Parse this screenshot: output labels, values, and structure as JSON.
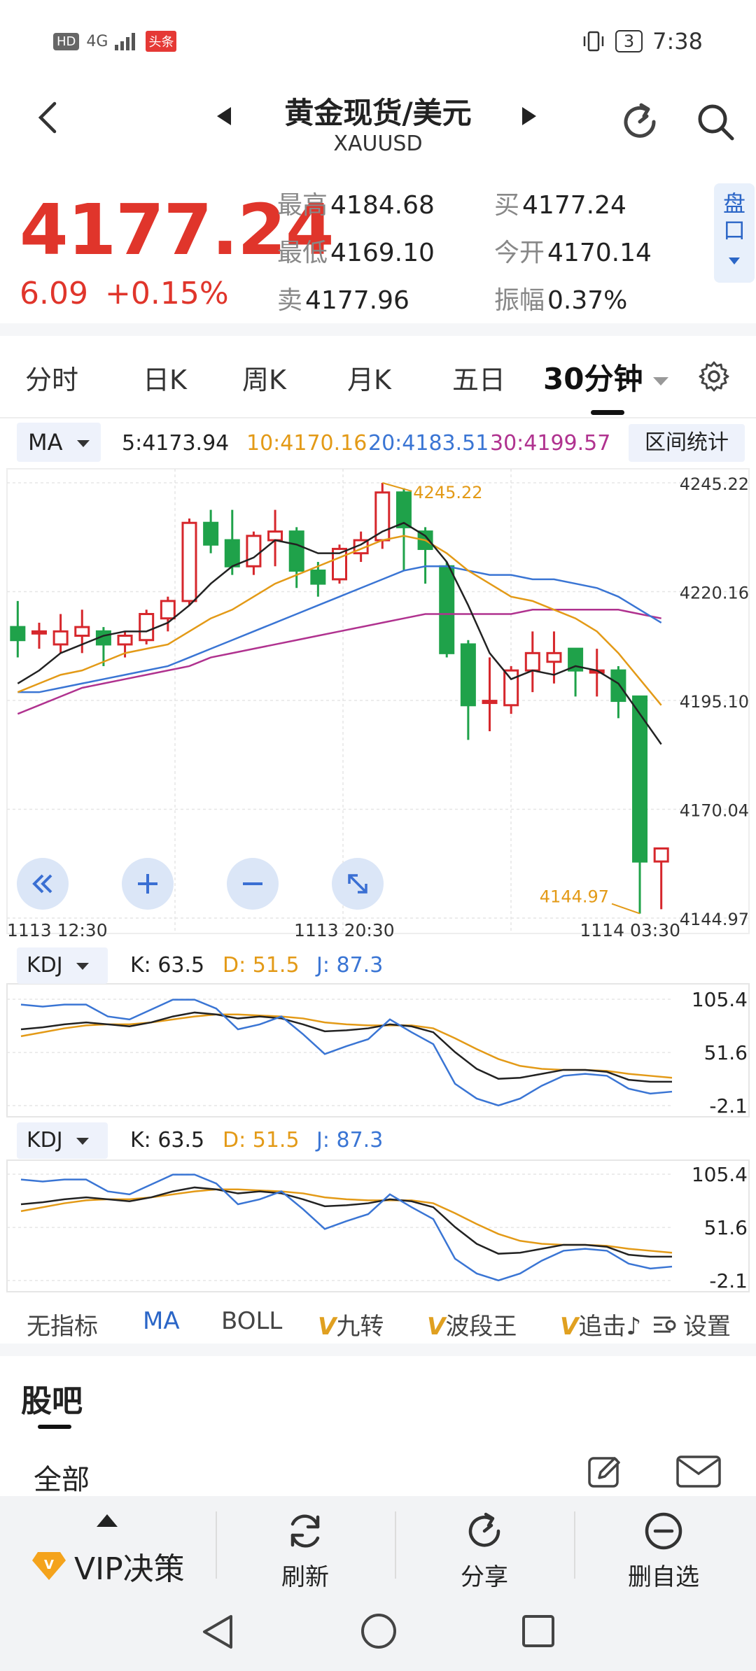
{
  "status": {
    "hd": "HD",
    "signal": "4G",
    "news_badge": "头条",
    "battery": "3",
    "time": "7:38"
  },
  "header": {
    "title": "黄金现货/美元",
    "symbol": "XAUUSD"
  },
  "quote": {
    "price": "4177.24",
    "change": "6.09",
    "change_pct": "+0.15%",
    "high_label": "最高",
    "high": "4184.68",
    "low_label": "最低",
    "low": "4169.10",
    "sell_label": "卖",
    "sell": "4177.96",
    "buy_label": "买",
    "buy": "4177.24",
    "open_label": "今开",
    "open": "4170.14",
    "amp_label": "振幅",
    "amp": "0.37%",
    "pankou": "盘口"
  },
  "tabs": [
    "分时",
    "日K",
    "周K",
    "月K",
    "五日",
    "30分钟"
  ],
  "ma_row": {
    "btn": "MA",
    "ma5": "5:4173.94",
    "ma10": "10:4170.16",
    "ma20": "20:4183.51",
    "ma30": "30:4199.57",
    "range_btn": "区间统计"
  },
  "colors": {
    "up": "#d6272c",
    "down": "#1fa24a",
    "ma5": "#222222",
    "ma10": "#e39a17",
    "ma20": "#3a75d4",
    "ma30": "#b0328f"
  },
  "chart_data": {
    "type": "candlestick",
    "y_ticks": [
      "4245.22",
      "4220.16",
      "4195.10",
      "4170.04",
      "4144.97"
    ],
    "ylim": [
      4144.97,
      4245.22
    ],
    "x_labels": [
      "1113  12:30",
      "1113  20:30",
      "1114  03:30"
    ],
    "max_label": "4245.22",
    "min_label": "4144.97",
    "candles": [
      {
        "o": 4212,
        "c": 4209,
        "h": 4218,
        "l": 4205
      },
      {
        "o": 4211,
        "c": 4211,
        "h": 4213,
        "l": 4207
      },
      {
        "o": 4208,
        "c": 4211,
        "h": 4215,
        "l": 4206
      },
      {
        "o": 4210,
        "c": 4212,
        "h": 4216,
        "l": 4206
      },
      {
        "o": 4211,
        "c": 4208,
        "h": 4212,
        "l": 4203
      },
      {
        "o": 4208,
        "c": 4210,
        "h": 4211,
        "l": 4205
      },
      {
        "o": 4209,
        "c": 4215,
        "h": 4216,
        "l": 4208
      },
      {
        "o": 4214,
        "c": 4218,
        "h": 4219,
        "l": 4211
      },
      {
        "o": 4218,
        "c": 4236,
        "h": 4237,
        "l": 4217
      },
      {
        "o": 4236,
        "c": 4231,
        "h": 4239,
        "l": 4229
      },
      {
        "o": 4232,
        "c": 4226,
        "h": 4239,
        "l": 4224
      },
      {
        "o": 4226,
        "c": 4233,
        "h": 4234,
        "l": 4224
      },
      {
        "o": 4232,
        "c": 4234,
        "h": 4239,
        "l": 4226
      },
      {
        "o": 4234,
        "c": 4225,
        "h": 4235,
        "l": 4221
      },
      {
        "o": 4225,
        "c": 4222,
        "h": 4227,
        "l": 4219
      },
      {
        "o": 4223,
        "c": 4230,
        "h": 4231,
        "l": 4222
      },
      {
        "o": 4229,
        "c": 4232,
        "h": 4234,
        "l": 4227
      },
      {
        "o": 4232,
        "c": 4243,
        "h": 4245.22,
        "l": 4230
      },
      {
        "o": 4243,
        "c": 4235,
        "h": 4244,
        "l": 4225
      },
      {
        "o": 4234,
        "c": 4230,
        "h": 4235,
        "l": 4222
      },
      {
        "o": 4226,
        "c": 4206,
        "h": 4227,
        "l": 4205
      },
      {
        "o": 4208,
        "c": 4194,
        "h": 4209,
        "l": 4186
      },
      {
        "o": 4195,
        "c": 4195,
        "h": 4205,
        "l": 4188
      },
      {
        "o": 4194,
        "c": 4202,
        "h": 4203,
        "l": 4192
      },
      {
        "o": 4202,
        "c": 4206,
        "h": 4211,
        "l": 4197
      },
      {
        "o": 4204,
        "c": 4206,
        "h": 4211,
        "l": 4199
      },
      {
        "o": 4207,
        "c": 4202,
        "h": 4207,
        "l": 4196
      },
      {
        "o": 4202,
        "c": 4202,
        "h": 4207,
        "l": 4196
      },
      {
        "o": 4202,
        "c": 4195,
        "h": 4203,
        "l": 4191
      },
      {
        "o": 4196,
        "c": 4158,
        "h": 4196,
        "l": 4146
      },
      {
        "o": 4158,
        "c": 4161,
        "h": 4161,
        "l": 4147
      }
    ],
    "ma5": [
      4199,
      4202,
      4206,
      4208,
      4210,
      4211,
      4211,
      4213,
      4217,
      4222,
      4226,
      4228,
      4232,
      4231,
      4229,
      4229,
      4231,
      4234,
      4236,
      4233,
      4227,
      4217,
      4206,
      4200,
      4202,
      4201,
      4203,
      4202,
      4199,
      4192,
      4185
    ],
    "ma10": [
      4197,
      4199,
      4201,
      4202,
      4204,
      4206,
      4207,
      4208,
      4211,
      4214,
      4216,
      4219,
      4222,
      4224,
      4226,
      4228,
      4230,
      4232,
      4233,
      4232,
      4229,
      4225,
      4222,
      4219,
      4218,
      4216,
      4214,
      4211,
      4206,
      4200,
      4194
    ],
    "ma20": [
      4197,
      4197,
      4198,
      4199,
      4200,
      4201,
      4202,
      4203,
      4205,
      4207,
      4209,
      4211,
      4213,
      4215,
      4217,
      4219,
      4221,
      4223,
      4225,
      4226,
      4226,
      4225,
      4224,
      4224,
      4223,
      4223,
      4222,
      4221,
      4219,
      4216,
      4213
    ],
    "ma30": [
      4192,
      4194,
      4196,
      4198,
      4199,
      4200,
      4201,
      4202,
      4203,
      4205,
      4206,
      4207,
      4208,
      4209,
      4210,
      4211,
      4212,
      4213,
      4214,
      4215,
      4215,
      4215,
      4215,
      4215,
      4216,
      4216,
      4216,
      4216,
      4216,
      4215,
      4214
    ],
    "kdj": {
      "label": "KDJ",
      "k_text": "K: 63.5",
      "d_text": "D: 51.5",
      "j_text": "J: 87.3",
      "ticks": [
        "105.4",
        "51.6",
        "-2.1"
      ],
      "ylim": [
        -2.1,
        105.4
      ],
      "k": [
        75,
        77,
        80,
        82,
        80,
        78,
        82,
        88,
        92,
        90,
        86,
        88,
        86,
        80,
        73,
        74,
        76,
        80,
        78,
        72,
        52,
        35,
        25,
        26,
        30,
        34,
        34,
        32,
        24,
        22,
        22
      ],
      "d": [
        68,
        72,
        76,
        79,
        80,
        80,
        82,
        85,
        88,
        90,
        90,
        89,
        88,
        86,
        82,
        80,
        79,
        79,
        79,
        76,
        66,
        55,
        45,
        38,
        35,
        34,
        34,
        33,
        30,
        28,
        26
      ],
      "j": [
        100,
        98,
        100,
        100,
        88,
        85,
        95,
        105,
        105,
        96,
        75,
        80,
        88,
        70,
        50,
        58,
        65,
        85,
        72,
        60,
        20,
        5,
        -2,
        5,
        18,
        28,
        30,
        28,
        15,
        10,
        12
      ]
    }
  },
  "controls": {
    "collapse_icon": "double-chevron-left-icon",
    "zoom_in_icon": "plus-icon",
    "zoom_out_icon": "minus-icon",
    "fullscreen_icon": "expand-icon"
  },
  "indicators": [
    {
      "label": "无指标"
    },
    {
      "label": "MA"
    },
    {
      "label": "BOLL"
    },
    {
      "v": "V",
      "label": "九转"
    },
    {
      "v": "V",
      "label": "波段王"
    },
    {
      "v": "V",
      "label": "追击♪"
    },
    {
      "label": "设置"
    }
  ],
  "guba": {
    "title": "股吧",
    "all": "全部"
  },
  "bottom_bar": {
    "vip": "VIP决策",
    "refresh": "刷新",
    "share": "分享",
    "remove": "删自选"
  }
}
